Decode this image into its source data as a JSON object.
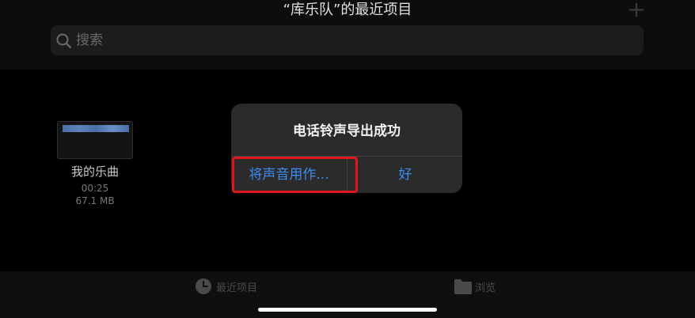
{
  "header": {
    "title": "“库乐队”的最近项目",
    "add_label": "+"
  },
  "search": {
    "placeholder": "搜索"
  },
  "file": {
    "name": "我的乐曲",
    "duration": "00:25",
    "size": "67.1 MB"
  },
  "alert": {
    "title": "电话铃声导出成功",
    "buttons": {
      "use_sound": "将声音用作...",
      "ok": "好"
    }
  },
  "tabbar": {
    "recent": "最近项目",
    "browse": "浏览"
  },
  "colors": {
    "accent": "#3d8bf0",
    "highlight": "#e0161d"
  }
}
